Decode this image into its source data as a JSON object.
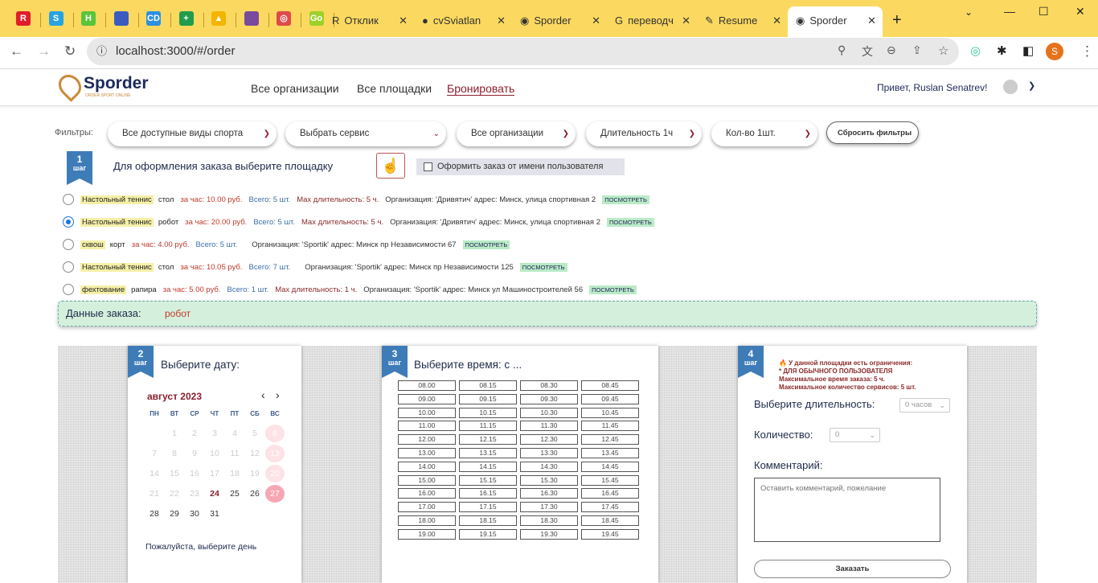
{
  "browser": {
    "pinned_tabs": [
      {
        "label": "R",
        "color": "#e01e2b"
      },
      {
        "label": "S",
        "color": "#29a3e0"
      },
      {
        "label": "H",
        "color": "#5ac43a"
      },
      {
        "label": "",
        "color": "#3b5bbf"
      },
      {
        "label": "CD",
        "color": "#2f8fe0"
      },
      {
        "label": "+",
        "color": "#1f9d4c"
      },
      {
        "label": "▲",
        "color": "#f4b400"
      },
      {
        "label": "",
        "color": "#7a4a9c"
      },
      {
        "label": "◎",
        "color": "#e04a4a"
      },
      {
        "label": "Go",
        "color": "#9cd12a"
      }
    ],
    "tabs": [
      {
        "title": "Отклик",
        "icon": "R"
      },
      {
        "title": "cvSviatlan",
        "icon": "●"
      },
      {
        "title": "Sporder",
        "icon": "◉"
      },
      {
        "title": "переводч",
        "icon": "G"
      },
      {
        "title": "Resume",
        "icon": "✎"
      },
      {
        "title": "Sporder",
        "icon": "◉"
      }
    ],
    "url": "localhost:3000/#/order",
    "profile_initial": "S"
  },
  "header": {
    "logo": "Sporder",
    "logo_tagline": "ORDER SPORT ONLINE",
    "nav": [
      "Все организации",
      "Все площадки",
      "Бронировать"
    ],
    "greeting": "Привет, Ruslan Senatrev!"
  },
  "filters": {
    "label": "Фильтры:",
    "selects": [
      "Все доступные виды спорта",
      "Выбрать сервис",
      "Все организации",
      "Длительность 1ч",
      "Кол-во 1шт."
    ],
    "reset": "Сбросить фильтры"
  },
  "step1": {
    "num": "1",
    "word": "шаг",
    "title": "Для оформления заказа выберите площадку",
    "checkbox_label": "Оформить заказ от имени пользователя"
  },
  "venues": [
    {
      "sport": "Настольный теннис",
      "service": "стол",
      "price": "за час: 10.00 руб.",
      "total": "Всего: 5 шт.",
      "max": "Max длительность: 5 ч.",
      "org": "Организация: 'Дривятич' адрес: Минск, улица спортивная 2",
      "look": "ПОСМОТРЕТЬ",
      "selected": false
    },
    {
      "sport": "Настольный теннис",
      "service": "робот",
      "price": "за час: 20.00 руб.",
      "total": "Всего: 5 шт.",
      "max": "Max длительность: 5 ч.",
      "org": "Организация: 'Дривятич' адрес: Минск, улица спортивная 2",
      "look": "ПОСМОТРЕТЬ",
      "selected": true
    },
    {
      "sport": "сквош",
      "service": "корт",
      "price": "за час: 4.00 руб.",
      "total": "Всего: 5 шт.",
      "max": "",
      "org": "Организация: 'Sportik' адрес: Минск пр Независимости 67",
      "look": "ПОСМОТРЕТЬ",
      "selected": false
    },
    {
      "sport": "Настольный теннис",
      "service": "стол",
      "price": "за час: 10.05 руб.",
      "total": "Всего: 7 шт.",
      "max": "",
      "org": "Организация: 'Sportik' адрес: Минск пр Независимости 125",
      "look": "ПОСМОТРЕТЬ",
      "selected": false
    },
    {
      "sport": "фехтование",
      "service": "рапира",
      "price": "за час: 5.00 руб.",
      "total": "Всего: 1 шт.",
      "max": "Max длительность: 1 ч.",
      "org": "Организация: 'Sportik' адрес: Минск ул Машиностроителей 56",
      "look": "ПОСМОТРЕТЬ",
      "selected": false
    }
  ],
  "order": {
    "label": "Данные заказа:",
    "value": "робот"
  },
  "step2": {
    "num": "2",
    "word": "шаг",
    "title": "Выберите дату:",
    "month": "август 2023",
    "weekdays": [
      "ПН",
      "ВТ",
      "СР",
      "ЧТ",
      "ПТ",
      "СБ",
      "ВС"
    ],
    "days": [
      "",
      "1",
      "2",
      "3",
      "4",
      "5",
      "6",
      "7",
      "8",
      "9",
      "10",
      "11",
      "12",
      "13",
      "14",
      "15",
      "16",
      "17",
      "18",
      "19",
      "20",
      "21",
      "22",
      "23",
      "24",
      "25",
      "26",
      "27",
      "28",
      "29",
      "30",
      "31"
    ],
    "today": "24",
    "highlighted": "27",
    "hint": "Пожалуйста, выберите день"
  },
  "step3": {
    "num": "3",
    "word": "шаг",
    "title": "Выберите время: с ...",
    "slots": [
      "08.00",
      "08.15",
      "08.30",
      "08.45",
      "09.00",
      "09.15",
      "09.30",
      "09.45",
      "10.00",
      "10.15",
      "10.30",
      "10.45",
      "11.00",
      "11.15",
      "11.30",
      "11.45",
      "12.00",
      "12.15",
      "12.30",
      "12.45",
      "13.00",
      "13.15",
      "13.30",
      "13.45",
      "14.00",
      "14.15",
      "14.30",
      "14.45",
      "15.00",
      "15.15",
      "15.30",
      "15.45",
      "16.00",
      "16.15",
      "16.30",
      "16.45",
      "17.00",
      "17.15",
      "17.30",
      "17.45",
      "18.00",
      "18.15",
      "18.30",
      "18.45",
      "19.00",
      "19.15",
      "19.30",
      "19.45"
    ]
  },
  "step4": {
    "num": "4",
    "word": "шаг",
    "limits": [
      "🔥 У данной площадки есть ограничения:",
      "* ДЛЯ ОБЫЧНОГО ПОЛЬЗОВАТЕЛЯ",
      "Максимальное время заказа: 5 ч.",
      "Максимальное количество сервисов: 5 шт."
    ],
    "duration_label": "Выберите длительность:",
    "duration_value": "0 часов",
    "qty_label": "Количество:",
    "qty_value": "0",
    "comment_label": "Комментарий:",
    "comment_placeholder": "Оставить комментарий, пожелание",
    "submit": "Заказать"
  },
  "colors": {
    "tabbar": "#fbd960",
    "ribbon": "#3e7cb8",
    "accent": "#8b1f2e",
    "order_bg": "#d4f0dc"
  }
}
